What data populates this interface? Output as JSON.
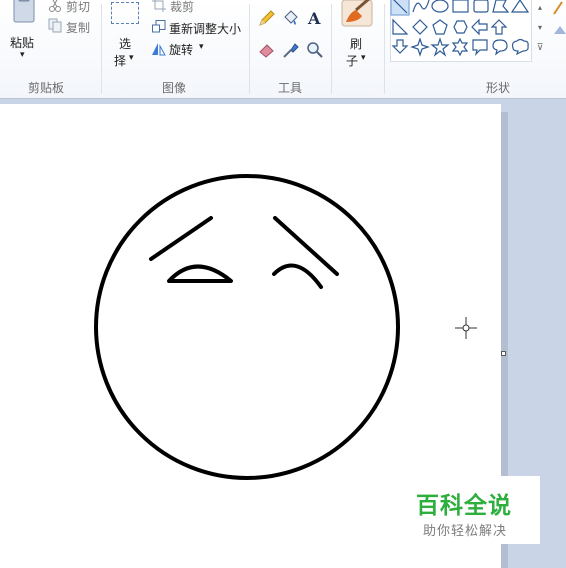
{
  "clipboard": {
    "paste_label": "粘贴",
    "cut_label": "剪切",
    "copy_label": "复制",
    "group_label": "剪贴板"
  },
  "image": {
    "select_label_top": "选",
    "select_label_bottom": "择",
    "crop_label": "裁剪",
    "resize_label": "重新调整大小",
    "rotate_label": "旋转",
    "group_label": "图像"
  },
  "tools": {
    "group_label": "工具",
    "items": [
      "pencil-icon",
      "fill-icon",
      "text-icon",
      "eraser-icon",
      "color-picker-icon",
      "magnifier-icon"
    ]
  },
  "brushes": {
    "label_top": "刷",
    "label_bottom": "子"
  },
  "shapes": {
    "group_label": "形状"
  },
  "watermark": {
    "title": "百科全说",
    "subtitle": "助你轻松解决"
  }
}
